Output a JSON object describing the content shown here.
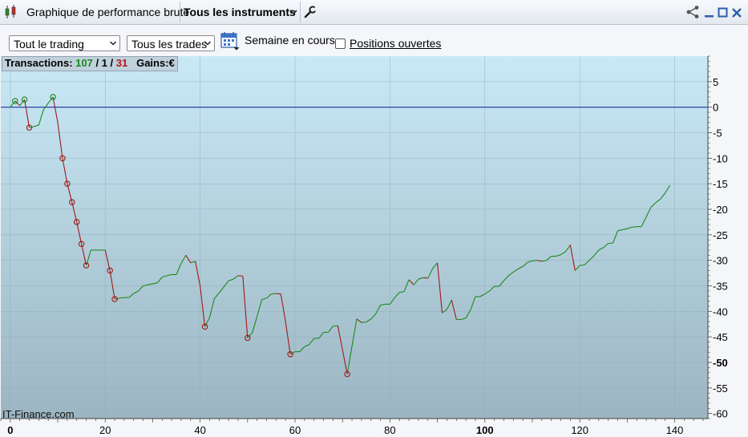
{
  "window": {
    "title": "Graphique de performance brute",
    "instrument_label": "Tous les instruments"
  },
  "toolbar": {
    "trading_select": "Tout le trading",
    "trades_select": "Tous les trades",
    "period_label": "Semaine en cours",
    "open_positions_label": "Positions ouvertes",
    "open_positions_checked": false
  },
  "stats": {
    "transactions_label": "Transactions:",
    "wins": "107",
    "sep1": " / ",
    "neutral": "1",
    "sep2": " / ",
    "losses": "31",
    "gains_label": "Gains:",
    "gains_unit": "€"
  },
  "watermark": "IT-Finance.com",
  "colors": {
    "up": "#1c8a1c",
    "down": "#a01818",
    "zero_line": "#1a2fa0",
    "bg_top": "#c9e9f6",
    "bg_bottom": "#9cb5c2"
  },
  "chart_data": {
    "type": "line",
    "title": "",
    "xlabel": "",
    "ylabel": "",
    "xlim": [
      -2,
      147
    ],
    "ylim": [
      -61,
      10
    ],
    "x_ticks": [
      {
        "value": 0,
        "label": "0",
        "bold": true
      },
      {
        "value": 20,
        "label": "20",
        "bold": false
      },
      {
        "value": 40,
        "label": "40",
        "bold": false
      },
      {
        "value": 60,
        "label": "60",
        "bold": false
      },
      {
        "value": 80,
        "label": "80",
        "bold": false
      },
      {
        "value": 100,
        "label": "100",
        "bold": true
      },
      {
        "value": 120,
        "label": "120",
        "bold": false
      },
      {
        "value": 140,
        "label": "140",
        "bold": false
      }
    ],
    "y_ticks": [
      {
        "value": 5,
        "label": "5",
        "bold": false
      },
      {
        "value": 0,
        "label": "0",
        "bold": false
      },
      {
        "value": -5,
        "label": "-5",
        "bold": false
      },
      {
        "value": -10,
        "label": "-10",
        "bold": false
      },
      {
        "value": -15,
        "label": "-15",
        "bold": false
      },
      {
        "value": -20,
        "label": "-20",
        "bold": false
      },
      {
        "value": -25,
        "label": "-25",
        "bold": false
      },
      {
        "value": -30,
        "label": "-30",
        "bold": false
      },
      {
        "value": -35,
        "label": "-35",
        "bold": false
      },
      {
        "value": -40,
        "label": "-40",
        "bold": false
      },
      {
        "value": -45,
        "label": "-45",
        "bold": false
      },
      {
        "value": -50,
        "label": "-50",
        "bold": true
      },
      {
        "value": -55,
        "label": "-55",
        "bold": false
      },
      {
        "value": -60,
        "label": "-60",
        "bold": false
      }
    ],
    "grid": true,
    "zero_line": 0,
    "series": [
      {
        "points": [
          [
            0,
            0
          ],
          [
            1,
            1.2
          ],
          [
            2,
            0.3
          ],
          [
            3,
            1.5
          ],
          [
            4,
            -4.0
          ],
          [
            5,
            -3.8
          ],
          [
            6,
            -3.5
          ],
          [
            7,
            -0.5
          ],
          [
            8,
            0.8
          ],
          [
            9,
            2.0
          ],
          [
            10,
            -3.0
          ],
          [
            11,
            -10.0
          ],
          [
            12,
            -15.0
          ],
          [
            13,
            -18.6
          ],
          [
            14,
            -22.5
          ],
          [
            15,
            -26.8
          ],
          [
            16,
            -31.0
          ],
          [
            17,
            -28.0
          ],
          [
            18,
            -28.0
          ],
          [
            19,
            -28.0
          ],
          [
            20,
            -28.0
          ],
          [
            21,
            -32.0
          ],
          [
            22,
            -37.6
          ],
          [
            23,
            -37.4
          ],
          [
            24,
            -37.3
          ],
          [
            25,
            -37.3
          ],
          [
            26,
            -36.5
          ],
          [
            27,
            -36.0
          ],
          [
            28,
            -35.0
          ],
          [
            29,
            -34.8
          ],
          [
            30,
            -34.6
          ],
          [
            31,
            -34.4
          ],
          [
            32,
            -33.3
          ],
          [
            33,
            -33.0
          ],
          [
            34,
            -32.8
          ],
          [
            35,
            -32.8
          ],
          [
            36,
            -30.6
          ],
          [
            37,
            -29.0
          ],
          [
            38,
            -30.5
          ],
          [
            39,
            -30.2
          ],
          [
            40,
            -35.0
          ],
          [
            41,
            -43.0
          ],
          [
            42,
            -41.2
          ],
          [
            43,
            -37.5
          ],
          [
            44,
            -36.4
          ],
          [
            45,
            -35.2
          ],
          [
            46,
            -34.0
          ],
          [
            47,
            -33.7
          ],
          [
            48,
            -33.0
          ],
          [
            49,
            -33.1
          ],
          [
            50,
            -45.2
          ],
          [
            51,
            -44.2
          ],
          [
            52,
            -41.0
          ],
          [
            53,
            -37.7
          ],
          [
            54,
            -37.4
          ],
          [
            55,
            -36.6
          ],
          [
            56,
            -36.5
          ],
          [
            57,
            -36.6
          ],
          [
            58,
            -42.0
          ],
          [
            59,
            -48.4
          ],
          [
            60,
            -47.9
          ],
          [
            61,
            -47.9
          ],
          [
            62,
            -46.9
          ],
          [
            63,
            -46.5
          ],
          [
            64,
            -45.3
          ],
          [
            65,
            -45.3
          ],
          [
            66,
            -44.1
          ],
          [
            67,
            -44.1
          ],
          [
            68,
            -42.9
          ],
          [
            69,
            -42.8
          ],
          [
            70,
            -47.5
          ],
          [
            71,
            -52.3
          ],
          [
            72,
            -46.8
          ],
          [
            73,
            -41.5
          ],
          [
            74,
            -42.2
          ],
          [
            75,
            -42.1
          ],
          [
            76,
            -41.5
          ],
          [
            77,
            -40.5
          ],
          [
            78,
            -38.8
          ],
          [
            79,
            -38.6
          ],
          [
            80,
            -38.6
          ],
          [
            81,
            -37.3
          ],
          [
            82,
            -36.3
          ],
          [
            83,
            -36.1
          ],
          [
            84,
            -33.8
          ],
          [
            85,
            -34.8
          ],
          [
            86,
            -33.7
          ],
          [
            87,
            -33.4
          ],
          [
            88,
            -33.5
          ],
          [
            89,
            -31.6
          ],
          [
            90,
            -30.5
          ],
          [
            91,
            -40.3
          ],
          [
            92,
            -39.6
          ],
          [
            93,
            -37.8
          ],
          [
            94,
            -41.6
          ],
          [
            95,
            -41.6
          ],
          [
            96,
            -41.3
          ],
          [
            97,
            -39.7
          ],
          [
            98,
            -37.1
          ],
          [
            99,
            -37.1
          ],
          [
            100,
            -36.6
          ],
          [
            101,
            -36.0
          ],
          [
            102,
            -35.1
          ],
          [
            103,
            -35.1
          ],
          [
            104,
            -34.0
          ],
          [
            105,
            -33.0
          ],
          [
            106,
            -32.3
          ],
          [
            107,
            -31.7
          ],
          [
            108,
            -31.2
          ],
          [
            109,
            -30.4
          ],
          [
            110,
            -30.1
          ],
          [
            111,
            -30.0
          ],
          [
            112,
            -30.2
          ],
          [
            113,
            -30.0
          ],
          [
            114,
            -29.2
          ],
          [
            115,
            -29.2
          ],
          [
            116,
            -28.9
          ],
          [
            117,
            -28.3
          ],
          [
            118,
            -27.0
          ],
          [
            119,
            -32.0
          ],
          [
            120,
            -31.0
          ],
          [
            121,
            -30.9
          ],
          [
            122,
            -30.0
          ],
          [
            123,
            -29.1
          ],
          [
            124,
            -28.0
          ],
          [
            125,
            -27.5
          ],
          [
            126,
            -26.7
          ],
          [
            127,
            -26.6
          ],
          [
            128,
            -24.2
          ],
          [
            129,
            -24.0
          ],
          [
            130,
            -23.8
          ],
          [
            131,
            -23.5
          ],
          [
            132,
            -23.4
          ],
          [
            133,
            -23.4
          ],
          [
            134,
            -21.5
          ],
          [
            135,
            -19.6
          ],
          [
            136,
            -18.7
          ],
          [
            137,
            -18.0
          ],
          [
            138,
            -16.8
          ],
          [
            139,
            -15.3
          ]
        ],
        "circle_markers": [
          1,
          3,
          4,
          9,
          11,
          12,
          13,
          14,
          15,
          16,
          21,
          22,
          41,
          50,
          59,
          71
        ]
      }
    ]
  }
}
